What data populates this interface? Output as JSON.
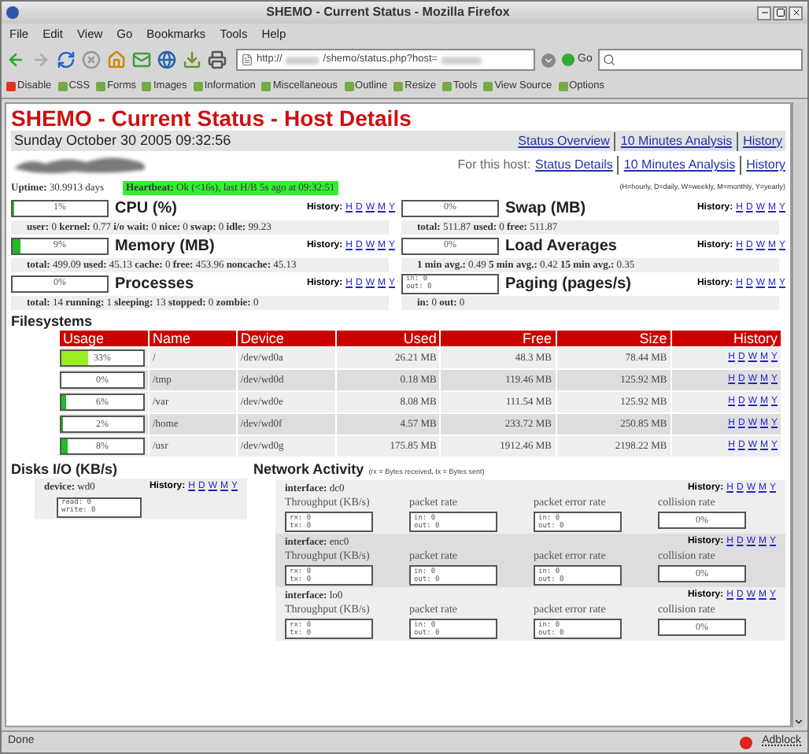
{
  "window": {
    "title": "SHEMO - Current Status - Mozilla Firefox"
  },
  "menu": [
    "File",
    "Edit",
    "View",
    "Go",
    "Bookmarks",
    "Tools",
    "Help"
  ],
  "address": {
    "scheme": "http://",
    "path": "/shemo/status.php?host="
  },
  "go_button": "Go",
  "dev_toolbar": [
    "Disable",
    "CSS",
    "Forms",
    "Images",
    "Information",
    "Miscellaneous",
    "Outline",
    "Resize",
    "Tools",
    "View Source",
    "Options"
  ],
  "page": {
    "heading": "SHEMO - Current Status - Host Details",
    "date": "Sunday October 30 2005 09:32:56",
    "top_links": [
      "Status Overview",
      "10 Minutes Analysis",
      "History"
    ],
    "host_label": "For this host:",
    "host_links": [
      "Status Details",
      "10 Minutes Analysis",
      "History"
    ],
    "uptime": "**Uptime:** 30.9913 days",
    "heartbeat": {
      "text": "**Heartbeat:** Ok (<16s), last H/B 5s ago at 09:32:51",
      "ok": true
    },
    "legend": "(H=hourly, D=daily, W=weekly, M=monthly, Y=yearly)",
    "panels": [
      {
        "kind": "gauge",
        "title": "CPU (%)",
        "reading": "1%",
        "level": 0.01,
        "history_label": "History:",
        "history": [
          "H",
          "D",
          "W",
          "M",
          "Y"
        ],
        "stats": "**user:** 0 **kernel:** 0.77 **i/o wait:** 0 **nice:** 0 **swap:** 0 **idle:** 99.23"
      },
      {
        "kind": "gauge",
        "title": "Swap (MB)",
        "reading": "0%",
        "level": 0,
        "history_label": "History:",
        "history": [
          "H",
          "D",
          "W",
          "M",
          "Y"
        ],
        "stats": "**total:** 511.87 **used:** 0 **free:** 511.87"
      },
      {
        "kind": "gauge",
        "title": "Memory (MB)",
        "reading": "9%",
        "level": 0.09,
        "history_label": "History:",
        "history": [
          "H",
          "D",
          "W",
          "M",
          "Y"
        ],
        "stats": "**total:** 499.09 **used:** 45.13 **cache:** 0 **free:** 453.96 **noncache:** 45.13"
      },
      {
        "kind": "gauge",
        "title": "Load Averages",
        "reading": "0%",
        "level": 0,
        "history_label": "History:",
        "history": [
          "H",
          "D",
          "W",
          "M",
          "Y"
        ],
        "stats": "**1 min avg.:** 0.49 **5 min avg.:** 0.42 **15 min avg.:** 0.35"
      },
      {
        "kind": "gauge",
        "title": "Processes",
        "reading": "0%",
        "level": 0,
        "history_label": "History:",
        "history": [
          "H",
          "D",
          "W",
          "M",
          "Y"
        ],
        "stats": "**total:** 14 **running:** 1 **sleeping:** 13 **stopped:** 0 **zombie:** 0"
      },
      {
        "kind": "counter",
        "title": "Paging (pages/s)",
        "lines": [
          "in: 0",
          "out: 0"
        ],
        "history_label": "History:",
        "history": [
          "H",
          "D",
          "W",
          "M",
          "Y"
        ],
        "stats": "**in:** 0 **out:** 0"
      }
    ],
    "filesystems": {
      "title": "Filesystems",
      "columns": [
        "Usage",
        "Name",
        "Device",
        "Used",
        "Free",
        "Size",
        "History"
      ],
      "rows": [
        {
          "usage": "33%",
          "level": 0.33,
          "name": "/",
          "device": "/dev/wd0a",
          "used": "26.21 MB",
          "free": "48.3 MB",
          "size": "78.44 MB",
          "history": [
            "H",
            "D",
            "W",
            "M",
            "Y"
          ]
        },
        {
          "usage": "0%",
          "level": 0,
          "name": "/tmp",
          "device": "/dev/wd0d",
          "used": "0.18 MB",
          "free": "119.46 MB",
          "size": "125.92 MB",
          "history": [
            "H",
            "D",
            "W",
            "M",
            "Y"
          ]
        },
        {
          "usage": "6%",
          "level": 0.06,
          "name": "/var",
          "device": "/dev/wd0e",
          "used": "8.08 MB",
          "free": "111.54 MB",
          "size": "125.92 MB",
          "history": [
            "H",
            "D",
            "W",
            "M",
            "Y"
          ]
        },
        {
          "usage": "2%",
          "level": 0.02,
          "name": "/home",
          "device": "/dev/wd0f",
          "used": "4.57 MB",
          "free": "233.72 MB",
          "size": "250.85 MB",
          "history": [
            "H",
            "D",
            "W",
            "M",
            "Y"
          ]
        },
        {
          "usage": "8%",
          "level": 0.08,
          "name": "/usr",
          "device": "/dev/wd0g",
          "used": "175.85 MB",
          "free": "1912.46 MB",
          "size": "2198.22 MB",
          "history": [
            "H",
            "D",
            "W",
            "M",
            "Y"
          ]
        }
      ]
    },
    "disks": {
      "title": "Disks I/O (KB/s)",
      "devices": [
        {
          "label": "**device:** wd0",
          "history_label": "History:",
          "history": [
            "H",
            "D",
            "W",
            "M",
            "Y"
          ],
          "lines": [
            "read: 0",
            "write: 0"
          ]
        }
      ]
    },
    "network": {
      "title": "Network Activity",
      "note": "(rx = Bytes received, tx = Bytes sent)",
      "interfaces": [
        {
          "label": "**interface:** dc0",
          "history_label": "History:",
          "history": [
            "H",
            "D",
            "W",
            "M",
            "Y"
          ],
          "metrics": [
            {
              "kind": "counter",
              "title": "Throughput (KB/s)",
              "lines": [
                "rx: 0",
                "tx: 0"
              ]
            },
            {
              "kind": "counter",
              "title": "packet rate",
              "lines": [
                "in: 0",
                "out: 0"
              ]
            },
            {
              "kind": "counter",
              "title": "packet error rate",
              "lines": [
                "in: 0",
                "out: 0"
              ]
            },
            {
              "kind": "gauge",
              "title": "collision rate",
              "reading": "0%",
              "level": 0
            }
          ]
        },
        {
          "label": "**interface:** enc0",
          "history_label": "History:",
          "history": [
            "H",
            "D",
            "W",
            "M",
            "Y"
          ],
          "metrics": [
            {
              "kind": "counter",
              "title": "Throughput (KB/s)",
              "lines": [
                "rx: 0",
                "tx: 0"
              ]
            },
            {
              "kind": "counter",
              "title": "packet rate",
              "lines": [
                "in: 0",
                "out: 0"
              ]
            },
            {
              "kind": "counter",
              "title": "packet error rate",
              "lines": [
                "in: 0",
                "out: 0"
              ]
            },
            {
              "kind": "gauge",
              "title": "collision rate",
              "reading": "0%",
              "level": 0
            }
          ]
        },
        {
          "label": "**interface:** lo0",
          "history_label": "History:",
          "history": [
            "H",
            "D",
            "W",
            "M",
            "Y"
          ],
          "metrics": [
            {
              "kind": "counter",
              "title": "Throughput (KB/s)",
              "lines": [
                "rx: 0",
                "tx: 0"
              ]
            },
            {
              "kind": "counter",
              "title": "packet rate",
              "lines": [
                "in: 0",
                "out: 0"
              ]
            },
            {
              "kind": "counter",
              "title": "packet error rate",
              "lines": [
                "in: 0",
                "out: 0"
              ]
            },
            {
              "kind": "gauge",
              "title": "collision rate",
              "reading": "0%",
              "level": 0
            }
          ]
        }
      ]
    }
  },
  "status_bar": {
    "text": "Done",
    "adblock": "Adblock"
  }
}
